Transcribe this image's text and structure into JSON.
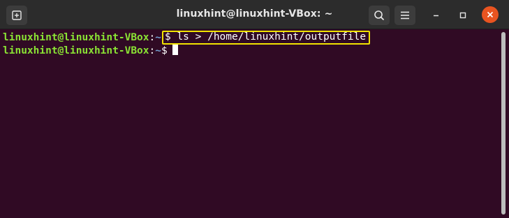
{
  "window": {
    "title": "linuxhint@linuxhint-VBox: ~",
    "buttons": {
      "new_tab_icon": "new-tab-icon",
      "search_icon": "search-icon",
      "menu_icon": "hamburger-menu-icon",
      "minimize_icon": "minimize-icon",
      "maximize_icon": "maximize-icon",
      "close_icon": "close-icon"
    }
  },
  "terminal": {
    "lines": [
      {
        "user_host": "linuxhint@linuxhint-VBox",
        "colon": ":",
        "path": "~",
        "command": "$ ls > /home/linuxhint/outputfile"
      },
      {
        "user_host": "linuxhint@linuxhint-VBox",
        "colon": ":",
        "path": "~",
        "prompt": "$"
      }
    ]
  },
  "colors": {
    "background": "#300a24",
    "titlebar": "#2c2c2c",
    "user_host": "#8ae234",
    "path": "#729fcf",
    "highlight_box": "#f2e400",
    "close_button": "#e95420"
  }
}
